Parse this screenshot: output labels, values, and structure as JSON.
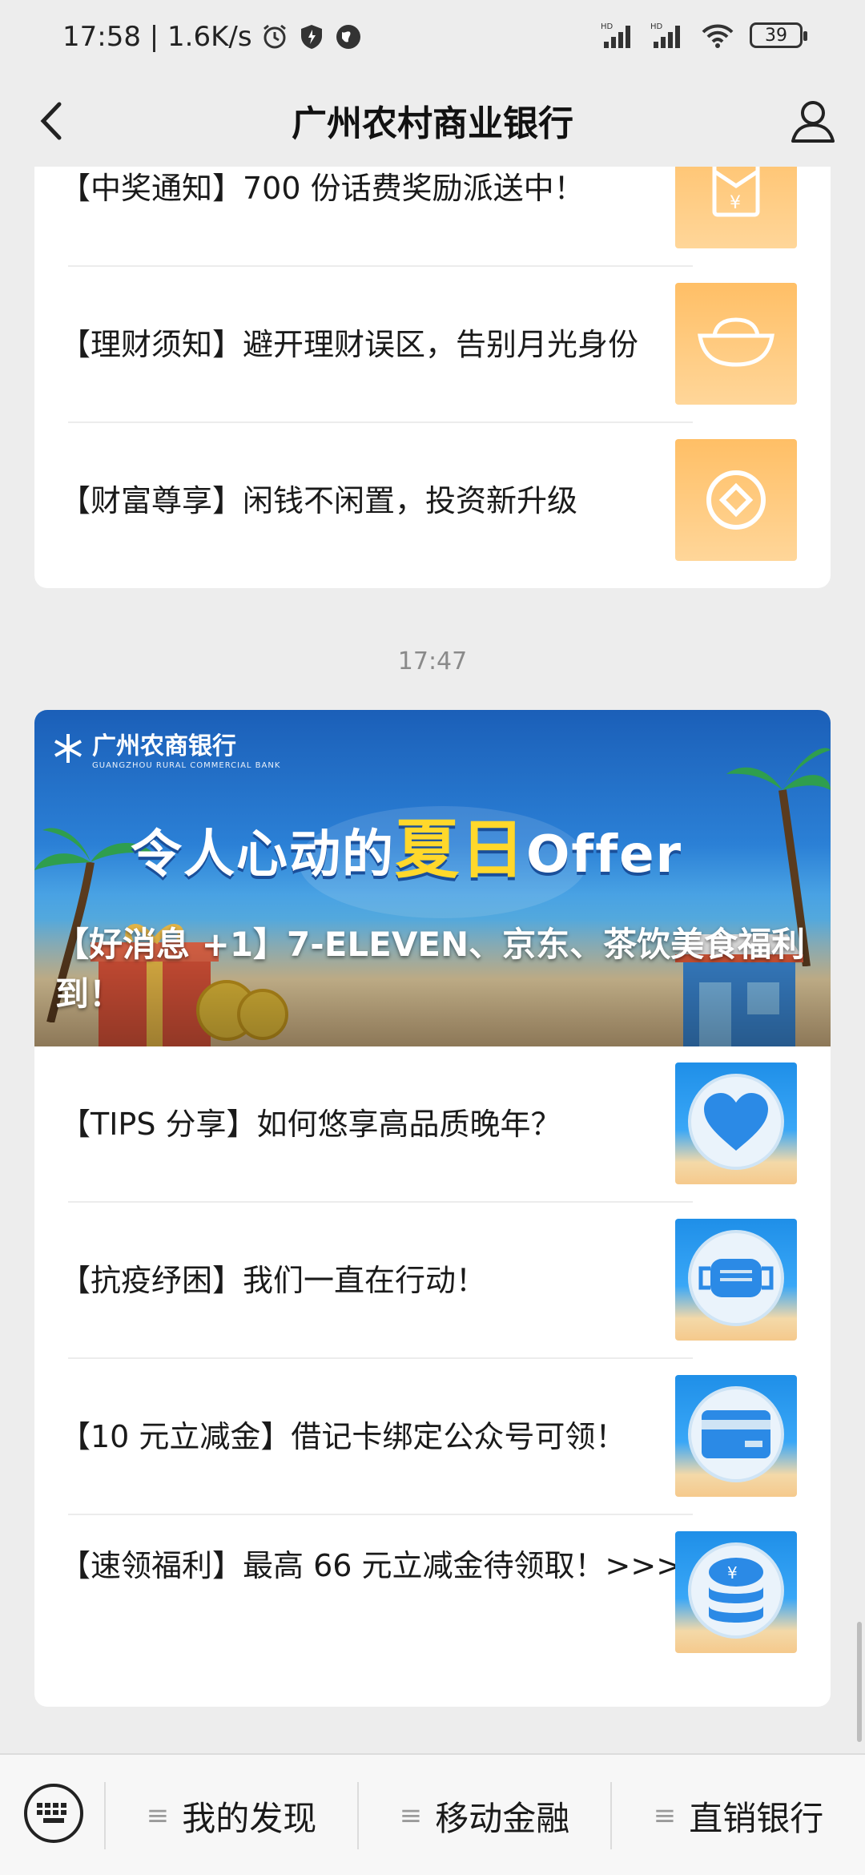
{
  "status_bar": {
    "time_speed": "17:58 | 1.6K/s",
    "battery": "39"
  },
  "nav": {
    "title": "广州农村商业银行"
  },
  "top_card": {
    "items": [
      {
        "title": "【中奖通知】700 份话费奖励派送中！",
        "thumb_icon": "red-envelope-icon"
      },
      {
        "title": "【理财须知】避开理财误区，告别月光身份",
        "thumb_icon": "gold-ingot-icon"
      },
      {
        "title": "【财富尊享】闲钱不闲置，投资新升级",
        "thumb_icon": "coin-icon"
      }
    ]
  },
  "timestamp": "17:47",
  "bottom_card": {
    "banner": {
      "logo_name": "广州农商银行",
      "logo_sub": "GUANGZHOU RURAL COMMERCIAL BANK",
      "slogan_pre": "令人心动的",
      "slogan_hl": "夏日",
      "slogan_post": "Offer",
      "title": "【好消息 +1】7-ELEVEN、京东、茶饮美食福利到！"
    },
    "items": [
      {
        "title": "【TIPS 分享】如何悠享高品质晚年？",
        "thumb_icon": "heart-icon"
      },
      {
        "title": "【抗疫纾困】我们一直在行动！",
        "thumb_icon": "face-mask-icon"
      },
      {
        "title": "【10 元立减金】借记卡绑定公众号可领！",
        "thumb_icon": "bank-card-icon"
      },
      {
        "title": "【速领福利】最高 66 元立减金待领取！>>>",
        "thumb_icon": "yuan-coins-icon"
      }
    ]
  },
  "bottom_menu": {
    "items": [
      "我的发现",
      "移动金融",
      "直销银行"
    ]
  },
  "colors": {
    "thumb_orange": "#ffbf66",
    "thumb_blue": "#1f8fe8",
    "banner_highlight": "#ffd82b"
  }
}
